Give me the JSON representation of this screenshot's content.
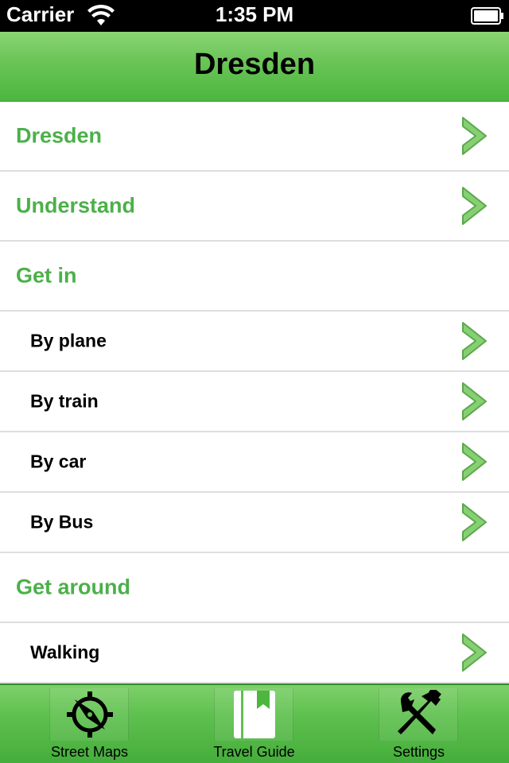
{
  "status_bar": {
    "carrier": "Carrier",
    "time": "1:35 PM"
  },
  "nav": {
    "title": "Dresden"
  },
  "list": {
    "rows": [
      {
        "label": "Dresden",
        "type": "section",
        "chevron": true
      },
      {
        "label": "Understand",
        "type": "section",
        "chevron": true
      },
      {
        "label": "Get in",
        "type": "section",
        "chevron": false
      },
      {
        "label": "By plane",
        "type": "sub",
        "chevron": true
      },
      {
        "label": "By train",
        "type": "sub",
        "chevron": true
      },
      {
        "label": "By car",
        "type": "sub",
        "chevron": true
      },
      {
        "label": "By Bus",
        "type": "sub",
        "chevron": true
      },
      {
        "label": "Get around",
        "type": "section",
        "chevron": false
      },
      {
        "label": "Walking",
        "type": "sub",
        "chevron": true
      }
    ]
  },
  "tabs": [
    {
      "label": "Street Maps",
      "icon": "compass-icon",
      "selected": false
    },
    {
      "label": "Travel Guide",
      "icon": "book-icon",
      "selected": true
    },
    {
      "label": "Settings",
      "icon": "tools-icon",
      "selected": false
    }
  ],
  "colors": {
    "accent_green": "#4cb04a",
    "chevron_green": "#7fcc6a",
    "nav_green": "#5fc04f"
  }
}
